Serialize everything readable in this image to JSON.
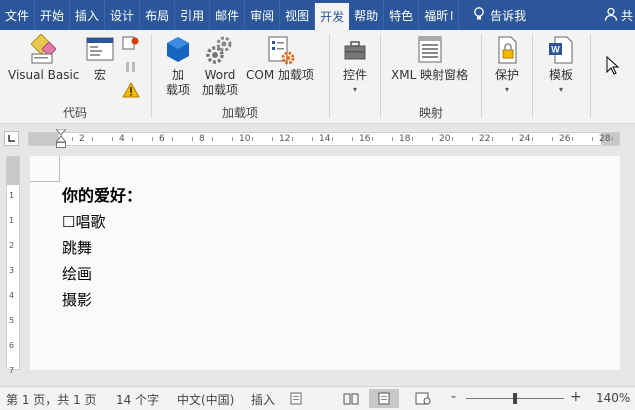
{
  "tabs": [
    {
      "label": "文件"
    },
    {
      "label": "开始"
    },
    {
      "label": "插入"
    },
    {
      "label": "设计"
    },
    {
      "label": "布局"
    },
    {
      "label": "引用"
    },
    {
      "label": "邮件"
    },
    {
      "label": "审阅"
    },
    {
      "label": "视图"
    },
    {
      "label": "开发"
    },
    {
      "label": "帮助"
    },
    {
      "label": "特色"
    },
    {
      "label": "福昕"
    }
  ],
  "active_tab": "开发",
  "tell_me": "告诉我",
  "share": "共",
  "ribbon": {
    "group_code": {
      "label": "代码",
      "visual_basic": "Visual Basic",
      "macro": "宏"
    },
    "group_addins": {
      "label": "加载项",
      "addins_line1": "加",
      "addins_line2": "载项",
      "word_addins_line1": "Word",
      "word_addins_line2": "加载项",
      "com_addins": "COM 加载项"
    },
    "group_controls": {
      "controls": "控件"
    },
    "group_mapping": {
      "label": "映射",
      "xml_mapping": "XML 映射窗格"
    },
    "group_protect": {
      "protect": "保护"
    },
    "group_templates": {
      "templates": "模板"
    }
  },
  "ruler": {
    "numbers": [
      "2",
      "4",
      "6",
      "8",
      "10",
      "12",
      "14",
      "16",
      "18",
      "20",
      "22",
      "24",
      "26",
      "28"
    ],
    "v_numbers": [
      "1",
      "1",
      "2",
      "3",
      "4",
      "5",
      "6",
      "7"
    ]
  },
  "document": {
    "lines": [
      "你的爱好：",
      "☐唱歌",
      "跳舞",
      "绘画",
      "摄影"
    ]
  },
  "status": {
    "page": "第 1 页，共 1 页",
    "words": "14 个字",
    "language": "中文(中国)",
    "mode": "插入",
    "zoom_minus": "-",
    "zoom_plus": "+",
    "zoom": "140%"
  },
  "colors": {
    "tab_bar": "#2b579a",
    "ribbon": "#f3f3f3",
    "addin_blue": "#1565c0"
  }
}
